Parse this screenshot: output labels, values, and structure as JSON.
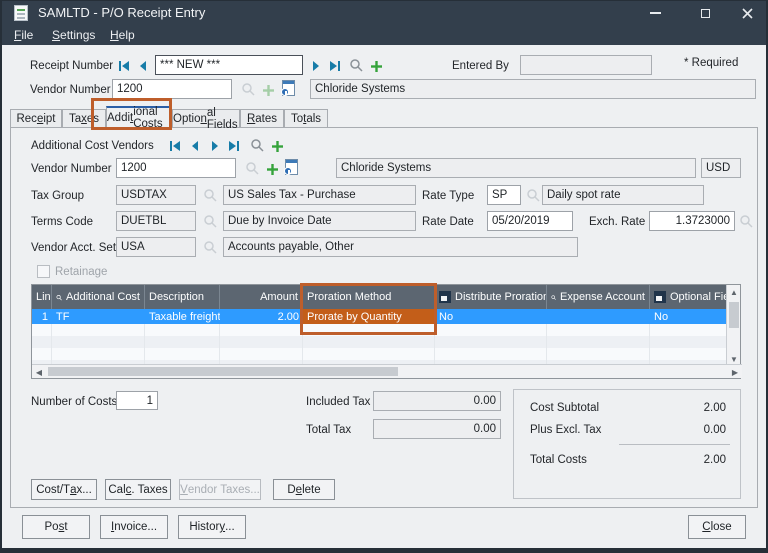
{
  "window": {
    "title": "SAMLTD - P/O Receipt Entry"
  },
  "menu": {
    "file": {
      "label": "File",
      "underline": 0
    },
    "settings": {
      "label": "Settings",
      "underline": 0
    },
    "help": {
      "label": "Help",
      "underline": 0
    }
  },
  "header": {
    "receipt_number_label": "Receipt Number",
    "receipt_number_value": "*** NEW ***",
    "entered_by_label": "Entered By",
    "entered_by_value": "",
    "required_note": "* Required",
    "vendor_number_label": "Vendor Number",
    "vendor_number_value": "1200",
    "vendor_name": "Chloride Systems"
  },
  "tabs": [
    {
      "label": "Receipt",
      "underline": 3
    },
    {
      "label": "Taxes",
      "underline": 2
    },
    {
      "label": "Additional Costs",
      "underline": 4,
      "active": true
    },
    {
      "label": "Optional Fields",
      "underline": 5
    },
    {
      "label": "Rates",
      "underline": 0
    },
    {
      "label": "Totals",
      "underline": 2
    }
  ],
  "tab_content": {
    "vendors_nav_label": "Additional Cost Vendors",
    "vendor_number_label": "Vendor Number",
    "vendor_number_value": "1200",
    "vendor_name": "Chloride Systems",
    "currency": "USD",
    "tax_group_label": "Tax Group",
    "tax_group_code": "USDTAX",
    "tax_group_desc": "US Sales Tax - Purchase",
    "rate_type_label": "Rate Type",
    "rate_type_code": "SP",
    "rate_type_desc": "Daily spot rate",
    "terms_label": "Terms Code",
    "terms_code": "DUETBL",
    "terms_desc": "Due by Invoice Date",
    "rate_date_label": "Rate Date",
    "rate_date_value": "05/20/2019",
    "exch_rate_label": "Exch. Rate",
    "exch_rate_value": "1.3723000",
    "vendor_acct_label": "Vendor Acct. Set",
    "vendor_acct_code": "USA",
    "vendor_acct_desc": "Accounts payable, Other",
    "retainage_label": "Retainage"
  },
  "grid": {
    "columns": [
      {
        "label": "Lin..."
      },
      {
        "label": "Additional Cost",
        "icon": "search"
      },
      {
        "label": "Description"
      },
      {
        "label": "Amount",
        "align": "right"
      },
      {
        "label": "Proration Method",
        "annotated": true
      },
      {
        "label": "Distribute Proration",
        "icon": "zoom"
      },
      {
        "label": "Expense Account",
        "icon": "search"
      },
      {
        "label": "Optional Fields",
        "icon": "zoom"
      }
    ],
    "rows": [
      {
        "line": "1",
        "additional_cost": "TF",
        "description": "Taxable freight",
        "amount": "2.00",
        "proration_method": "Prorate by Quantity",
        "distribute_proration": "No",
        "expense_account": "",
        "optional_fields": "No"
      }
    ]
  },
  "summary": {
    "number_of_costs_label": "Number of Costs",
    "number_of_costs_value": "1",
    "included_tax_label": "Included Tax",
    "included_tax_value": "0.00",
    "total_tax_label": "Total Tax",
    "total_tax_value": "0.00",
    "cost_subtotal_label": "Cost Subtotal",
    "cost_subtotal_value": "2.00",
    "plus_excl_tax_label": "Plus Excl. Tax",
    "plus_excl_tax_value": "0.00",
    "total_costs_label": "Total Costs",
    "total_costs_value": "2.00"
  },
  "buttons": {
    "cost_tax": {
      "label": "Cost/Tax...",
      "underline": 6
    },
    "calc_taxes": {
      "label": "Calc. Taxes",
      "underline": 3
    },
    "vendor_taxes": {
      "label": "Vendor Taxes...",
      "underline": 0
    },
    "delete": {
      "label": "Delete",
      "underline": 1
    },
    "post": {
      "label": "Post",
      "underline": 2
    },
    "invoice": {
      "label": "Invoice...",
      "underline": 0
    },
    "history": {
      "label": "History...",
      "underline": 6
    },
    "close": {
      "label": "Close",
      "underline": 0
    }
  },
  "icons": {
    "search": "magnifier",
    "add": "green-plus",
    "drilldown": "page-info",
    "nav": "teal-arrows",
    "grid_zoom": "dark-square-detail"
  },
  "colors": {
    "title_bar": "#333F4C",
    "selected_row": "#2E9BFF",
    "grid_header": "#5C6671",
    "annotation_orange": "#BE5E2B",
    "annotation_fill": "#C35E19",
    "nav_teal": "#177CA8",
    "plus_green": "#35A33B",
    "tab_accent": "#2B5FA7"
  }
}
